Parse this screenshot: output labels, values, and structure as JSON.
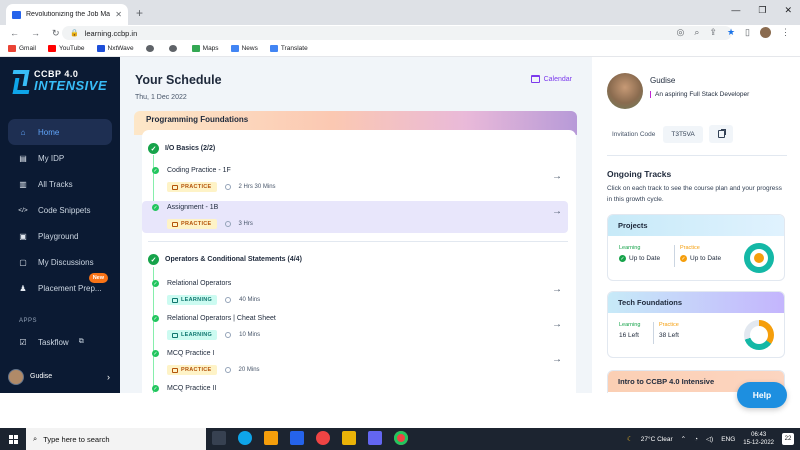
{
  "browser": {
    "tab_title": "Revolutionizing the Job Market | ...",
    "tab_close": "✕",
    "new_tab": "+",
    "url": "learning.ccbp.in",
    "bookmarks": [
      {
        "label": "Gmail",
        "color": "#ea4335"
      },
      {
        "label": "YouTube",
        "color": "#ff0000"
      },
      {
        "label": "NxtWave",
        "color": "#1d4ed8"
      },
      {
        "label": "",
        "color": "#5f6368"
      },
      {
        "label": "",
        "color": "#5f6368"
      },
      {
        "label": "Maps",
        "color": "#34a853"
      },
      {
        "label": "News",
        "color": "#4285f4"
      },
      {
        "label": "Translate",
        "color": "#4285f4"
      }
    ]
  },
  "sidebar": {
    "logo_line1": "CCBP 4.0",
    "logo_line2": "INTENSIVE",
    "items": [
      {
        "label": "Home",
        "icon": "⌂"
      },
      {
        "label": "My IDP",
        "icon": "▤"
      },
      {
        "label": "All Tracks",
        "icon": "▥"
      },
      {
        "label": "Code Snippets",
        "icon": "</>"
      },
      {
        "label": "Playground",
        "icon": "▣"
      },
      {
        "label": "My Discussions",
        "icon": "▢"
      },
      {
        "label": "Placement Prep...",
        "icon": "♟"
      }
    ],
    "new_badge": "New",
    "apps_label": "APPS",
    "taskflow_label": "Taskflow",
    "taskflow_icon": "☑",
    "external_icon": "⧉",
    "user_name": "Gudise",
    "user_chevron": "›"
  },
  "main": {
    "title": "Your Schedule",
    "date": "Thu, 1 Dec 2022",
    "calendar_label": "Calendar",
    "section_banner": "Programming Foundations",
    "arrow": "→",
    "check": "✓",
    "sections": [
      {
        "title": "I/O Basics (2/2)",
        "items": [
          {
            "title": "Coding Practice - 1F",
            "tag": "PRACTICE",
            "duration": "2 Hrs 30 Mins"
          },
          {
            "title": "Assignment - 1B",
            "tag": "PRACTICE",
            "duration": "3 Hrs"
          }
        ]
      },
      {
        "title": "Operators & Conditional Statements (4/4)",
        "items": [
          {
            "title": "Relational Operators",
            "tag": "LEARNING",
            "duration": "40 Mins"
          },
          {
            "title": "Relational Operators | Cheat Sheet",
            "tag": "LEARNING",
            "duration": "10 Mins"
          },
          {
            "title": "MCQ Practice I",
            "tag": "PRACTICE",
            "duration": "20 Mins"
          },
          {
            "title": "MCQ Practice II",
            "tag": "",
            "duration": ""
          }
        ]
      }
    ]
  },
  "profile": {
    "name": "Gudise",
    "description": "An aspiring Full Stack Developer",
    "invitation_label": "Invitation Code",
    "invitation_code": "T3T5VA"
  },
  "tracks": {
    "title": "Ongoing Tracks",
    "description": "Click on each track to see the course plan and your progress in this growth cycle.",
    "cards": [
      {
        "title": "Projects",
        "learning_label": "Learning",
        "learning_value": "Up to Date",
        "practice_label": "Practice",
        "practice_value": "Up to Date",
        "header_gradient": "linear-gradient(90deg, #c7eaf8, #e0f2fe)",
        "ring_color": "#14b8a6",
        "core_color": "#f59e0b"
      },
      {
        "title": "Tech Foundations",
        "learning_label": "Learning",
        "learning_value": "16 Left",
        "practice_label": "Practice",
        "practice_value": "38 Left",
        "header_gradient": "linear-gradient(90deg, #c7eaf8, #c4b5fd)",
        "ring_color": "#14b8a6",
        "core_color": "#f59e0b"
      },
      {
        "title": "Intro to CCBP 4.0 Intensive",
        "header_gradient": "linear-gradient(90deg, #fbcfb4, #fcd5c0)"
      }
    ]
  },
  "help_label": "Help",
  "taskbar": {
    "search_placeholder": "Type here to search",
    "weather": "27°C  Clear",
    "lang": "ENG",
    "time": "06:43",
    "date": "15-12-2022",
    "notifications": "22"
  }
}
